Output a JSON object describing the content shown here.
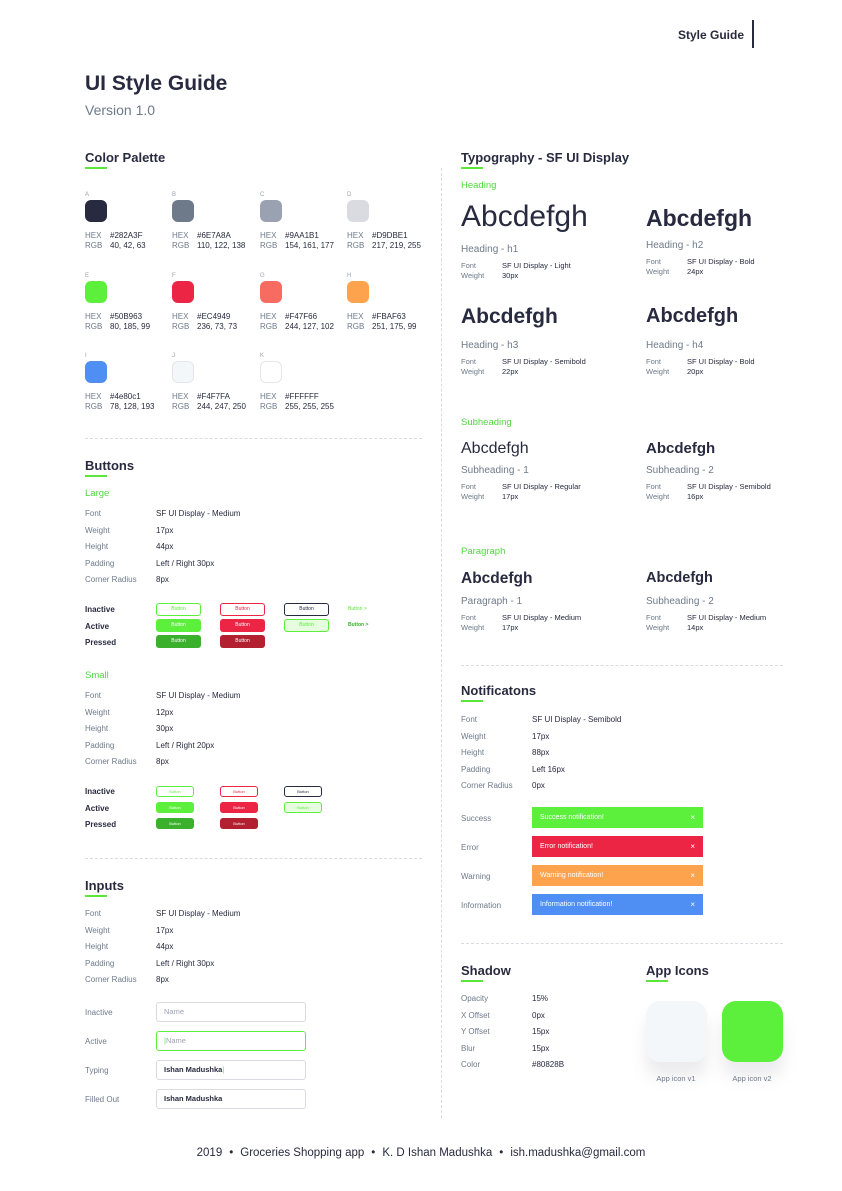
{
  "header": {
    "tag": "Style Guide",
    "title": "UI Style Guide",
    "version": "Version 1.0"
  },
  "colors": {
    "title": "Color Palette",
    "hex_label": "HEX",
    "rgb_label": "RGB",
    "swatches": [
      {
        "letter": "A",
        "hex": "#282A3F",
        "rgb": "40, 42, 63"
      },
      {
        "letter": "B",
        "hex": "#6E7A8A",
        "rgb": "110, 122, 138"
      },
      {
        "letter": "C",
        "hex": "#9AA1B1",
        "rgb": "154, 161, 177"
      },
      {
        "letter": "D",
        "hex": "#D9DBE1",
        "rgb": "217, 219, 255"
      },
      {
        "letter": "E",
        "hex": "#50B963",
        "rgb": "80, 185, 99"
      },
      {
        "letter": "F",
        "hex": "#EC4949",
        "rgb": "236, 73, 73"
      },
      {
        "letter": "G",
        "hex": "#F47F66",
        "rgb": "244, 127, 102"
      },
      {
        "letter": "H",
        "hex": "#FBAF63",
        "rgb": "251, 175, 99"
      },
      {
        "letter": "I",
        "hex": "#4e80c1",
        "rgb": "78, 128, 193"
      },
      {
        "letter": "J",
        "hex": "#F4F7FA",
        "rgb": "244, 247, 250"
      },
      {
        "letter": "K",
        "hex": "#FFFFFF",
        "rgb": "255, 255, 255"
      }
    ],
    "swatch_fill": [
      "#282A3F",
      "#6E7A8A",
      "#9AA1B1",
      "#D9DBE1",
      "#5CF03C",
      "#EC2545",
      "#F76B61",
      "#FDA34D",
      "#4F8EF3",
      "#F4F7FA",
      "#FFFFFF"
    ]
  },
  "buttons": {
    "title": "Buttons",
    "large": {
      "label": "Large",
      "specs": [
        {
          "k": "Font",
          "v": "SF UI Display - Medium"
        },
        {
          "k": "Weight",
          "v": "17px"
        },
        {
          "k": "Height",
          "v": "44px"
        },
        {
          "k": "Padding",
          "v": "Left / Right 30px"
        },
        {
          "k": "Corner Radius",
          "v": "8px"
        }
      ]
    },
    "small": {
      "label": "Small",
      "specs": [
        {
          "k": "Font",
          "v": "SF UI Display - Medium"
        },
        {
          "k": "Weight",
          "v": "12px"
        },
        {
          "k": "Height",
          "v": "30px"
        },
        {
          "k": "Padding",
          "v": "Left / Right 20px"
        },
        {
          "k": "Corner Radius",
          "v": "8px"
        }
      ]
    },
    "states": {
      "inactive": "Inactive",
      "active": "Active",
      "pressed": "Pressed"
    },
    "button_text": "Button",
    "link_text": "Button  >"
  },
  "inputs": {
    "title": "Inputs",
    "specs": [
      {
        "k": "Font",
        "v": "SF UI Display - Medium"
      },
      {
        "k": "Weight",
        "v": "17px"
      },
      {
        "k": "Height",
        "v": "44px"
      },
      {
        "k": "Padding",
        "v": "Left / Right 30px"
      },
      {
        "k": "Corner Radius",
        "v": "8px"
      }
    ],
    "states": [
      {
        "label": "Inactive",
        "value": "Name"
      },
      {
        "label": "Active",
        "value": "Name"
      },
      {
        "label": "Typing",
        "value": "Ishan Madushka"
      },
      {
        "label": "Filled Out",
        "value": "Ishan Madushka"
      }
    ]
  },
  "typography": {
    "title": "Typography - SF UI Display",
    "font_label": "Font",
    "weight_label": "Weight",
    "sample": "Abcdefgh",
    "heading_label": "Heading",
    "subheading_label": "Subheading",
    "paragraph_label": "Paragraph",
    "items": [
      {
        "name": "Heading - h1",
        "font": "SF UI Display - Light",
        "weight": "30px"
      },
      {
        "name": "Heading - h2",
        "font": "SF UI Display - Bold",
        "weight": "24px"
      },
      {
        "name": "Heading - h3",
        "font": "SF UI Display - Semibold",
        "weight": "22px"
      },
      {
        "name": "Heading - h4",
        "font": "SF UI Display - Bold",
        "weight": "20px"
      },
      {
        "name": "Subheading - 1",
        "font": "SF UI Display - Regular",
        "weight": "17px"
      },
      {
        "name": "Subheading - 2",
        "font": "SF UI Display - Semibold",
        "weight": "16px"
      },
      {
        "name": "Paragraph - 1",
        "font": "SF UI Display - Medium",
        "weight": "17px"
      },
      {
        "name": "Subheading - 2",
        "font": "SF UI Display - Medium",
        "weight": "14px"
      }
    ]
  },
  "notifications": {
    "title": "Notificatons",
    "specs": [
      {
        "k": "Font",
        "v": "SF UI Display - Semibold"
      },
      {
        "k": "Weight",
        "v": "17px"
      },
      {
        "k": "Height",
        "v": "88px"
      },
      {
        "k": "Padding",
        "v": "Left 16px"
      },
      {
        "k": "Corner Radius",
        "v": "0px"
      }
    ],
    "items": [
      {
        "label": "Success",
        "text": "Success notification!",
        "color": "#5CF03C"
      },
      {
        "label": "Error",
        "text": "Error notification!",
        "color": "#EC2545"
      },
      {
        "label": "Warning",
        "text": "Warning notification!",
        "color": "#FDA34D"
      },
      {
        "label": "Information",
        "text": "Information notification!",
        "color": "#4F8EF3"
      }
    ],
    "close_glyph": "×"
  },
  "shadow": {
    "title": "Shadow",
    "specs": [
      {
        "k": "Opacity",
        "v": "15%"
      },
      {
        "k": "X Offset",
        "v": "0px"
      },
      {
        "k": "Y Offset",
        "v": "15px"
      },
      {
        "k": "Blur",
        "v": "15px"
      },
      {
        "k": "Color",
        "v": "#80828B"
      }
    ]
  },
  "app_icons": {
    "title": "App Icons",
    "items": [
      {
        "label": "App icon v1",
        "color": "#F4F7FA"
      },
      {
        "label": "App icon v2",
        "color": "#5CF03C"
      }
    ]
  },
  "footer": {
    "year": "2019",
    "project": "Groceries Shopping app",
    "author": "K. D Ishan Madushka",
    "email": "ish.madushka@gmail.com",
    "separator": "•"
  }
}
